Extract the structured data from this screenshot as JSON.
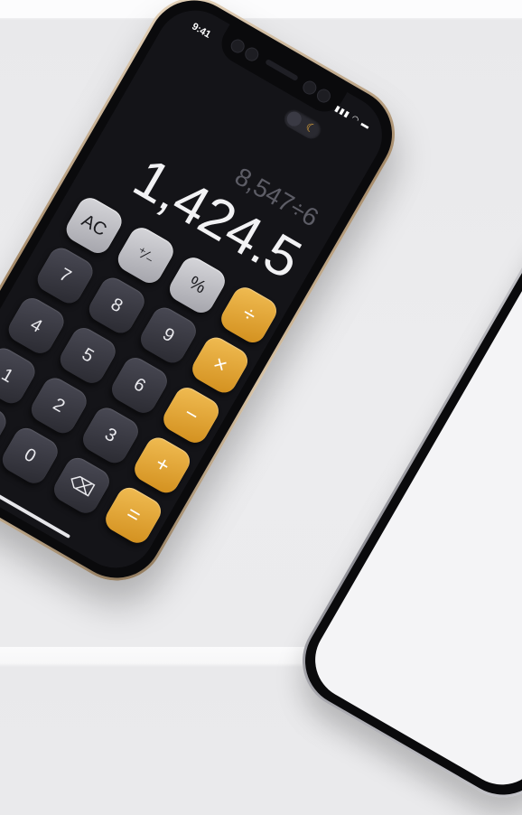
{
  "status": {
    "time": "9:41",
    "icons": "▮▮▮ ◠ ▬"
  },
  "theme_toggle": {
    "icon": "moon-icon",
    "icon_glyph": "☾",
    "light_icon": "sun-icon",
    "light_glyph": "☼"
  },
  "display": {
    "expression": "8,547÷6",
    "result": "1,424.5"
  },
  "keys": {
    "ac": "AC",
    "plusminus": "⁺∕₋",
    "percent": "%",
    "divide": "÷",
    "k7": "7",
    "k8": "8",
    "k9": "9",
    "multiply": "×",
    "k4": "4",
    "k5": "5",
    "k6": "6",
    "minus": "−",
    "k1": "1",
    "k2": "2",
    "k3": "3",
    "plus": "+",
    "dot": ".",
    "k0": "0",
    "backspace": "⌫",
    "equals": "="
  },
  "colors": {
    "accent": "#e6a93b",
    "background": "#141418",
    "light_screen": "#f4f4f6"
  }
}
